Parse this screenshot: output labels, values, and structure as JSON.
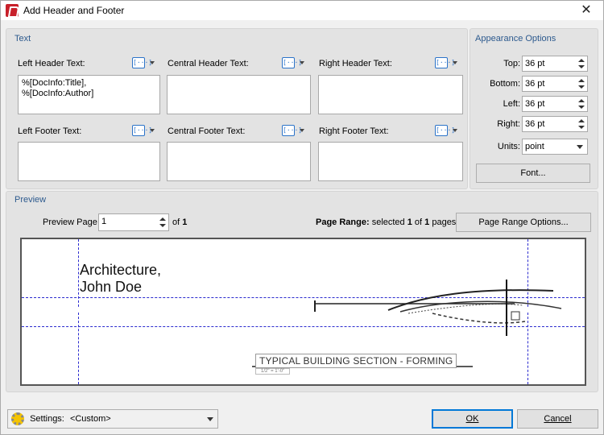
{
  "window": {
    "title": "Add Header and Footer",
    "close_glyph": "✕"
  },
  "text_panel": {
    "title": "Text",
    "left_header_label": "Left Header Text:",
    "central_header_label": "Central Header Text:",
    "right_header_label": "Right Header Text:",
    "left_footer_label": "Left Footer Text:",
    "central_footer_label": "Central Footer Text:",
    "right_footer_label": "Right Footer Text:",
    "left_header_value_line1": "%[DocInfo:Title],",
    "left_header_value_line2": "%[DocInfo:Author]",
    "macro_glyph": "[···]"
  },
  "appearance": {
    "title": "Appearance Options",
    "top_label": "Top:",
    "top_value": "36 pt",
    "bottom_label": "Bottom:",
    "bottom_value": "36 pt",
    "left_label": "Left:",
    "left_value": "36 pt",
    "right_label": "Right:",
    "right_value": "36 pt",
    "units_label": "Units:",
    "units_value": "point",
    "font_button": "Font..."
  },
  "preview": {
    "title": "Preview",
    "page_label": "Preview Page",
    "page_value": "1",
    "of_label": "of",
    "of_total": "1",
    "range_bold": "Page Range:",
    "range_text1": " selected ",
    "range_selected": "1",
    "range_text2": " of ",
    "range_total": "1",
    "range_text3": " pages",
    "range_button": "Page Range Options...",
    "header_line1": "Architecture,",
    "header_line2": "John Doe",
    "drawing_title": "TYPICAL BUILDING SECTION - FORMING",
    "drawing_scale": "1/2\" = 1'-0\""
  },
  "footer": {
    "settings_label": "Settings:",
    "settings_value": "<Custom>",
    "ok_button": "OK",
    "cancel_button": "Cancel"
  },
  "icons": {
    "app": "pdf-app-icon",
    "macro": "insert-macro-icon",
    "settings": "gear-icon"
  },
  "colors": {
    "accent": "#0078d7",
    "guide": "#2b2bcf",
    "group_title": "#2d5a8e",
    "app_icon": "#c8202a"
  }
}
